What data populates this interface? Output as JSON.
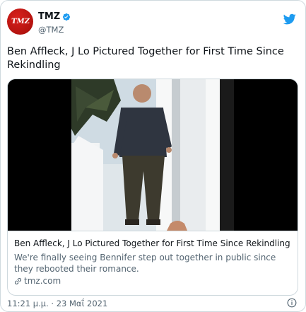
{
  "author": {
    "avatar_text": "TMZ",
    "display_name": "TMZ",
    "handle": "@TMZ"
  },
  "tweet": {
    "text": "Ben Affleck, J Lo Pictured Together for First Time Since Rekindling",
    "timestamp": "11:21 μ.μ. · 23 Μαΐ 2021"
  },
  "card": {
    "title": "Ben Affleck, J Lo Pictured Together for First Time Since Rekindling",
    "description": "We're finally seeing Bennifer step out together in public since they rebooted their romance.",
    "domain": "tmz.com"
  },
  "colors": {
    "twitter_blue": "#1d9bf0",
    "brand_red": "#c8140f",
    "secondary_text": "#536471",
    "border": "#cfd9de"
  },
  "icons": {
    "verified": "verified-badge-icon",
    "twitter": "twitter-bird-icon",
    "link": "link-icon",
    "info": "info-icon"
  }
}
